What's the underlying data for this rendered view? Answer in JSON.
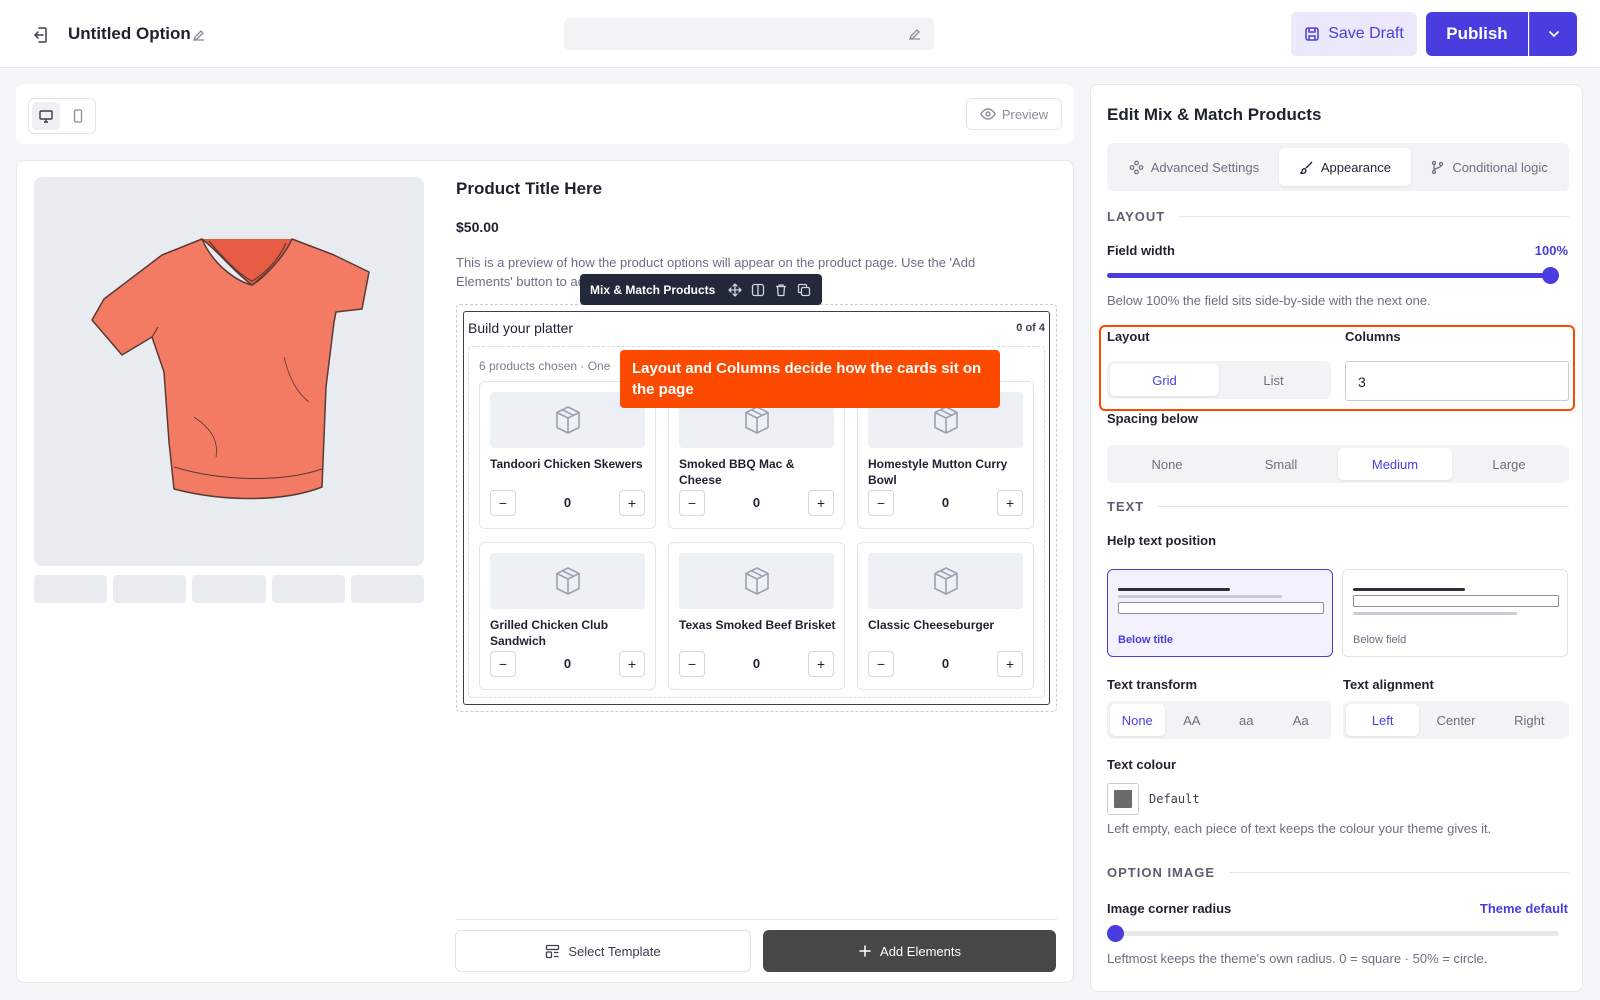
{
  "header": {
    "title": "Untitled Option",
    "save_draft_label": "Save Draft",
    "publish_label": "Publish"
  },
  "canvas_toolbar": {
    "preview_label": "Preview"
  },
  "product": {
    "title": "Product Title Here",
    "price": "$50.00",
    "description": "This is a preview of how the product options will appear on the product page. Use the 'Add Elements' button to add elements and customize their settings."
  },
  "block": {
    "title": "Build your platter",
    "count": "0 of 4",
    "chosen_note": "6 products chosen · One",
    "toolbar_label": "Mix & Match Products",
    "products": [
      {
        "name": "Tandoori Chicken Skewers",
        "qty": "0"
      },
      {
        "name": "Smoked BBQ Mac & Cheese",
        "qty": "0"
      },
      {
        "name": "Homestyle Mutton Curry Bowl",
        "qty": "0"
      },
      {
        "name": "Grilled Chicken Club Sandwich",
        "qty": "0"
      },
      {
        "name": "Texas Smoked Beef Brisket",
        "qty": "0"
      },
      {
        "name": "Classic Cheeseburger",
        "qty": "0"
      }
    ],
    "minus": "−",
    "plus": "+"
  },
  "callout": {
    "text": "Layout and Columns decide how the cards sit on the page"
  },
  "footer": {
    "select_template_label": "Select Template",
    "add_elements_label": "Add Elements"
  },
  "panel": {
    "title": "Edit Mix & Match Products",
    "tabs": [
      "Advanced Settings",
      "Appearance",
      "Conditional logic"
    ],
    "layout_section": "LAYOUT",
    "field_width_label": "Field width",
    "field_width_value": "100%",
    "field_width_level": 1.0,
    "field_width_help": "Below 100% the field sits side-by-side with the next one.",
    "layout_label": "Layout",
    "layout_options": [
      "Grid",
      "List"
    ],
    "layout_selected": "Grid",
    "columns_label": "Columns",
    "columns_value": "3",
    "spacing_label": "Spacing below",
    "spacing_options": [
      "None",
      "Small",
      "Medium",
      "Large"
    ],
    "spacing_selected": "Medium",
    "text_section": "TEXT",
    "help_pos_label": "Help text position",
    "help_pos_options": [
      "Below title",
      "Below field"
    ],
    "help_pos_selected": "Below title",
    "transform_label": "Text transform",
    "transform_options": [
      "None",
      "AA",
      "aa",
      "Aa"
    ],
    "transform_selected": "None",
    "alignment_label": "Text alignment",
    "alignment_options": [
      "Left",
      "Center",
      "Right"
    ],
    "alignment_selected": "Left",
    "colour_label": "Text colour",
    "colour_value": "Default",
    "colour_swatch": "#6b6b6b",
    "colour_help": "Left empty, each piece of text keeps the colour your theme gives it.",
    "image_section": "OPTION IMAGE",
    "radius_label": "Image corner radius",
    "radius_value": "Theme default",
    "radius_level": 0.0,
    "radius_help": "Leftmost keeps the theme's own radius. 0 = square · 50% = circle."
  },
  "colors": {
    "accent": "#4a3de0",
    "callout": "#fc4a00",
    "shirt": "#f47b63"
  }
}
